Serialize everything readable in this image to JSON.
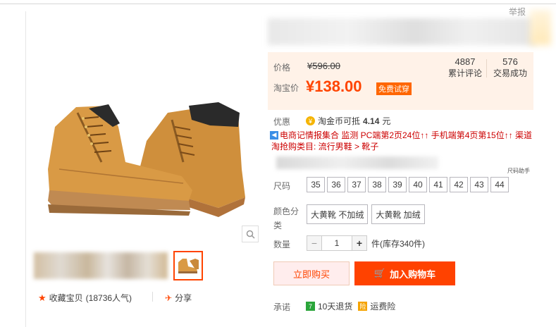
{
  "header": {
    "report_label": "举报"
  },
  "gallery": {
    "zoom_icon": "magnifier-icon",
    "favorite": {
      "icon": "star-icon",
      "label": "收藏宝贝",
      "count": "(18736人气)"
    },
    "share": {
      "icon": "share-icon",
      "label": "分享"
    }
  },
  "price": {
    "label": "价格",
    "original": "¥596.00",
    "taobao_label": "淘宝价",
    "current": "¥138.00",
    "trial_badge": "免费试穿",
    "reviews_count": "4887",
    "reviews_label": "累计评论",
    "deals_count": "576",
    "deals_label": "交易成功"
  },
  "promo": {
    "label": "优惠",
    "coin_icon": "coin-icon",
    "coin_text": "淘金币可抵",
    "coin_amount": "4.14",
    "coin_unit": "元",
    "info_line": "电商记情报集合 监测 PC端第2页24位↑↑ 手机端第4页第15位↑↑ 渠道",
    "category_line": "淘抢购类目: 流行男鞋 > 靴子"
  },
  "sku": {
    "size_chart_label": "尺码助手",
    "size_label": "尺码",
    "sizes": [
      "35",
      "36",
      "37",
      "38",
      "39",
      "40",
      "41",
      "42",
      "43",
      "44"
    ],
    "color_label": "颜色分类",
    "colors": [
      "大黄靴 不加绒",
      "大黄靴 加绒"
    ],
    "quantity_label": "数量",
    "quantity_value": "1",
    "stock_text": "件(库存340件)"
  },
  "actions": {
    "buy_now": "立即购买",
    "add_to_cart": "加入购物车",
    "cart_icon": "cart-icon"
  },
  "promise": {
    "label": "承诺",
    "return_badge": "7",
    "return_text": "10天退货",
    "insurance_badge": "险",
    "insurance_text": "运费险"
  },
  "colors": {
    "accent": "#ff4400",
    "price_bg": "#fff2e8",
    "cart_button": "#ff4200"
  }
}
